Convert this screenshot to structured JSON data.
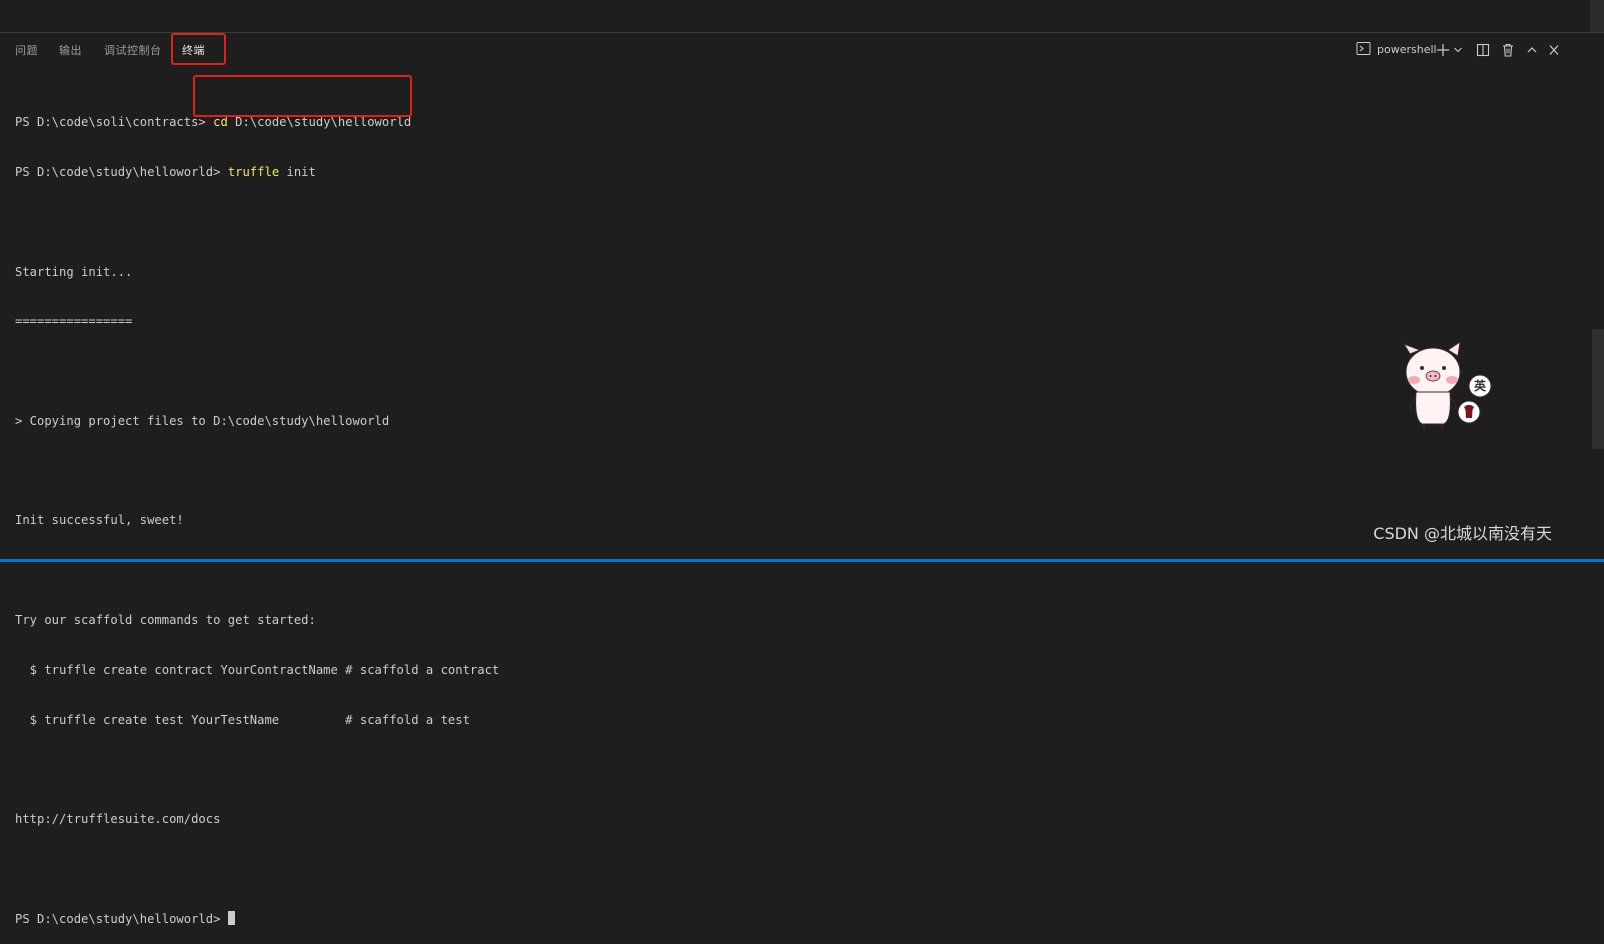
{
  "tabs": [
    {
      "label": "问题",
      "active": false
    },
    {
      "label": "输出",
      "active": false
    },
    {
      "label": "调试控制台",
      "active": false
    },
    {
      "label": "终端",
      "active": true
    }
  ],
  "toolbar": {
    "shell_label": "powershell",
    "shell_icon": "terminal-icon",
    "add_icon": "plus-icon",
    "dropdown_icon": "chevron-down-icon",
    "split_icon": "split-icon",
    "delete_icon": "trash-icon",
    "maximize_icon": "chevron-up-icon",
    "close_icon": "close-icon"
  },
  "terminal": {
    "line1_prompt": "PS D:\\code\\soli\\contracts> ",
    "line1_kw": "cd",
    "line1_rest": " D:\\code\\study\\helloworld",
    "line2_prompt": "PS D:\\code\\study\\helloworld> ",
    "line2_kw": "truffle",
    "line2_rest": " init",
    "line3": "",
    "line4": "Starting init...",
    "line5": "================",
    "line6": "",
    "line7": "> Copying project files to D:\\code\\study\\helloworld",
    "line8": "",
    "line9": "Init successful, sweet!",
    "line10": "",
    "line11": "Try our scaffold commands to get started:",
    "line12": "  $ truffle create contract YourContractName # scaffold a contract",
    "line13": "  $ truffle create test YourTestName         # scaffold a test",
    "line14": "",
    "line15": "http://trufflesuite.com/docs",
    "line16": "",
    "line17_prompt": "PS D:\\code\\study\\helloworld> "
  },
  "ime": {
    "badge_text": "英"
  },
  "watermark": "CSDN @北城以南没有天",
  "colors": {
    "background": "#1e1e1e",
    "highlight_box": "#e0211a",
    "command_keyword": "#f0e46f",
    "status_bar": "#007acc"
  }
}
